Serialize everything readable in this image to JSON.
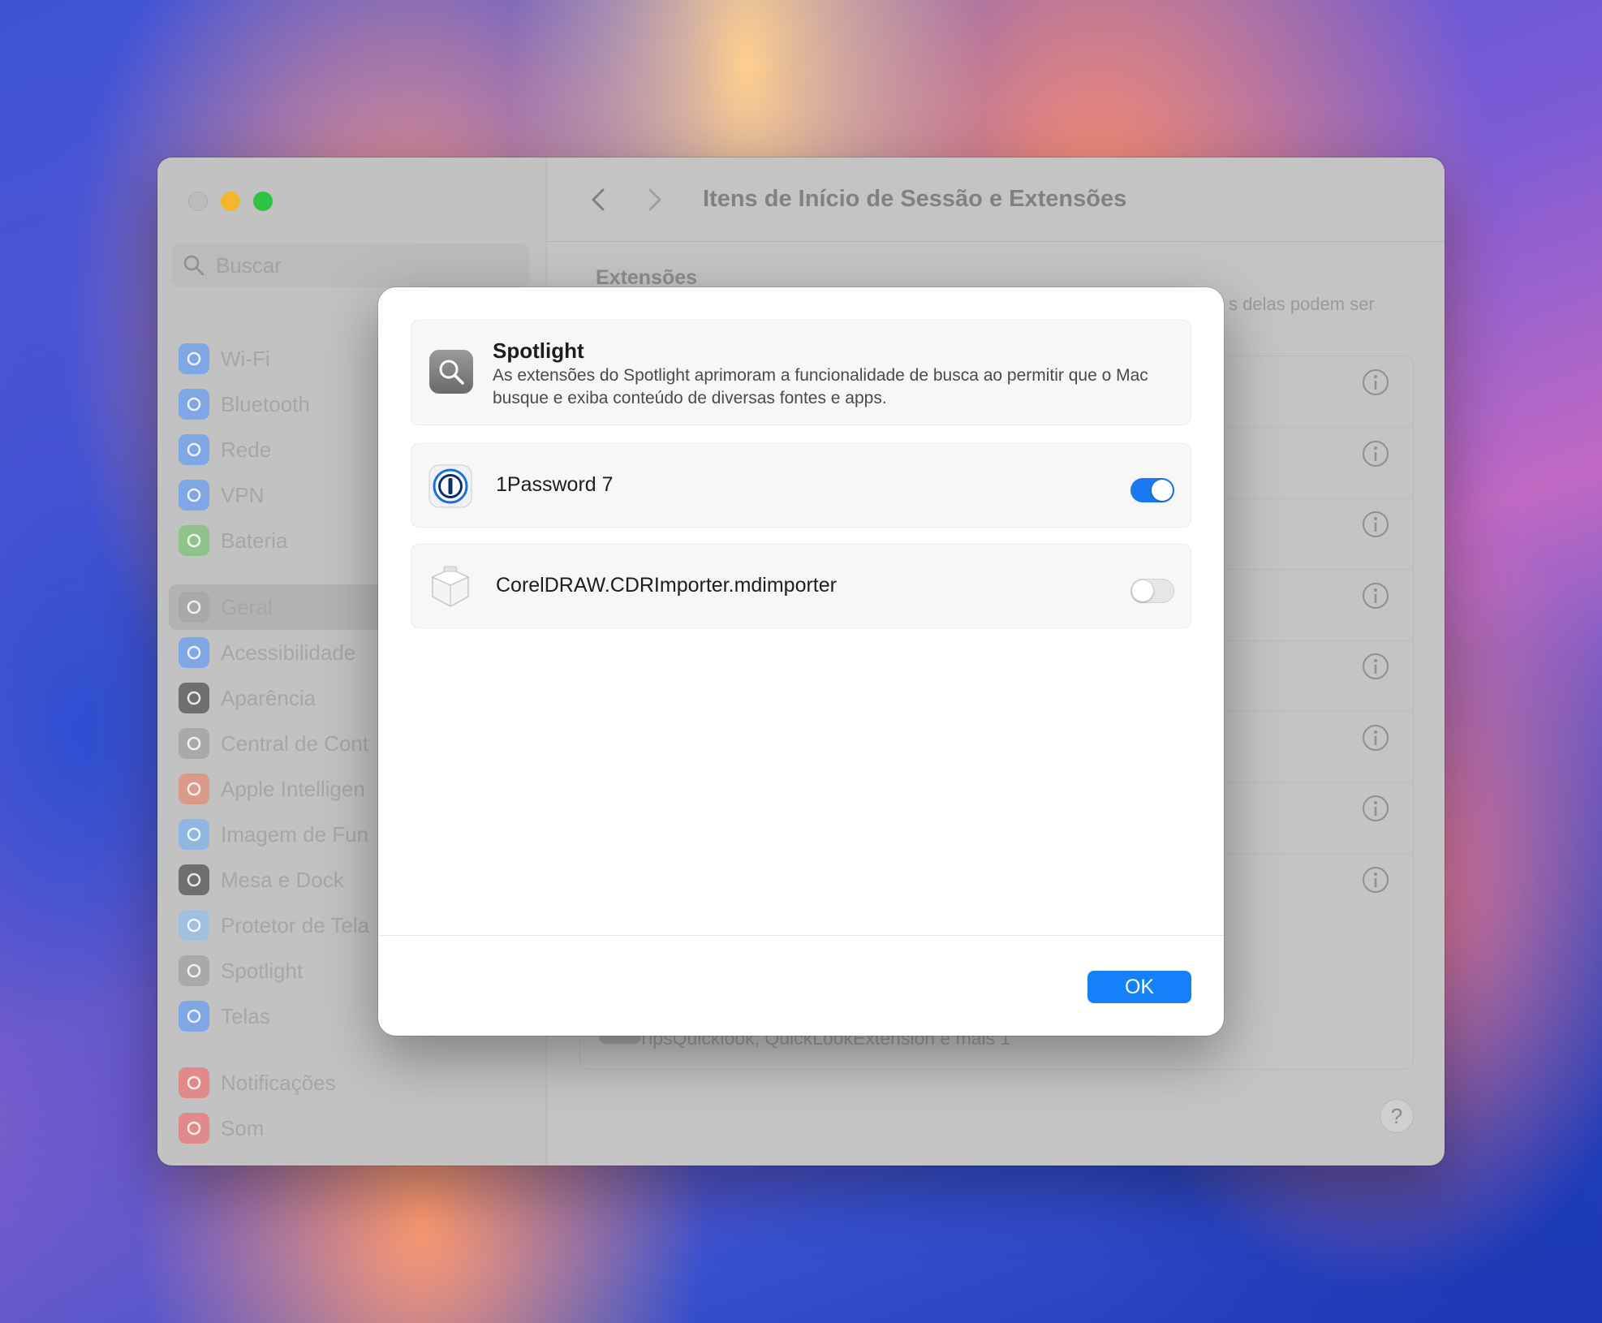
{
  "window": {
    "title": "Itens de Início de Sessão e Extensões",
    "search_placeholder": "Buscar",
    "section_title": "Extensões",
    "section_desc_fragment": "s delas podem ser",
    "bottom_text": "TipsQuicklook, QuickLookExtension e mais 1",
    "help_label": "?"
  },
  "sidebar": {
    "groups": [
      [
        {
          "label": "Wi-Fi",
          "icon": "wifi-icon",
          "color": "#7fa7e6"
        },
        {
          "label": "Bluetooth",
          "icon": "bluetooth-icon",
          "color": "#7fa7e6"
        },
        {
          "label": "Rede",
          "icon": "globe-icon",
          "color": "#7fa7e6"
        },
        {
          "label": "VPN",
          "icon": "vpn-globe-icon",
          "color": "#7fa7e6"
        },
        {
          "label": "Bateria",
          "icon": "battery-icon",
          "color": "#8ec48a"
        }
      ],
      [
        {
          "label": "Geral",
          "icon": "gear-icon",
          "color": "#a9a9a9",
          "selected": true
        },
        {
          "label": "Acessibilidade",
          "icon": "accessibility-icon",
          "color": "#7fa7e6"
        },
        {
          "label": "Aparência",
          "icon": "appearance-icon",
          "color": "#6f6f6f"
        },
        {
          "label": "Central de Cont",
          "icon": "control-center-icon",
          "color": "#a9a9a9"
        },
        {
          "label": "Apple Intelligen",
          "icon": "apple-intelligence-icon",
          "color": "#d99a8a"
        },
        {
          "label": "Imagem de Fun",
          "icon": "wallpaper-icon",
          "color": "#8fb6e0"
        },
        {
          "label": "Mesa e Dock",
          "icon": "dock-icon",
          "color": "#6f6f6f"
        },
        {
          "label": "Protetor de Tela",
          "icon": "screensaver-icon",
          "color": "#9fc0e0"
        },
        {
          "label": "Spotlight",
          "icon": "spotlight-icon",
          "color": "#a9a9a9"
        },
        {
          "label": "Telas",
          "icon": "display-icon",
          "color": "#7fa7e6"
        }
      ],
      [
        {
          "label": "Notificações",
          "icon": "notification-bell-icon",
          "color": "#e08a8a"
        },
        {
          "label": "Som",
          "icon": "speaker-icon",
          "color": "#e08a8a"
        }
      ]
    ]
  },
  "dialog": {
    "title": "Spotlight",
    "description": "As extensões do Spotlight aprimoram a funcionalidade de busca ao permitir que o Mac busque e exiba conteúdo de diversas fontes e apps.",
    "items": [
      {
        "label": "1Password 7",
        "icon": "1password-icon",
        "enabled": true
      },
      {
        "label": "CorelDRAW.CDRImporter.mdimporter",
        "icon": "generic-plugin-icon",
        "enabled": false
      }
    ],
    "ok_label": "OK"
  },
  "colors": {
    "accent": "#1580f8",
    "toggle_on": "#1a78f2"
  }
}
